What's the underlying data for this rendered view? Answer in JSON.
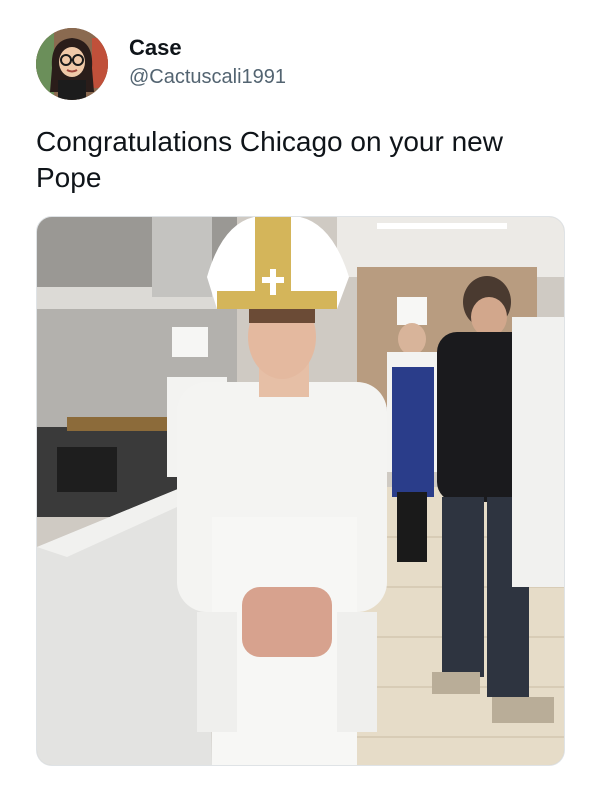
{
  "user": {
    "display_name": "Case",
    "handle": "@Cactuscali1991",
    "avatar_icon": "cartoon-avatar-icon"
  },
  "tweet": {
    "text": "Congratulations Chicago on your new Pope"
  },
  "media": {
    "type": "photo",
    "icon": "photo-icon"
  },
  "colors": {
    "text": "#0f1419",
    "secondary": "#536471",
    "background": "#ffffff"
  }
}
